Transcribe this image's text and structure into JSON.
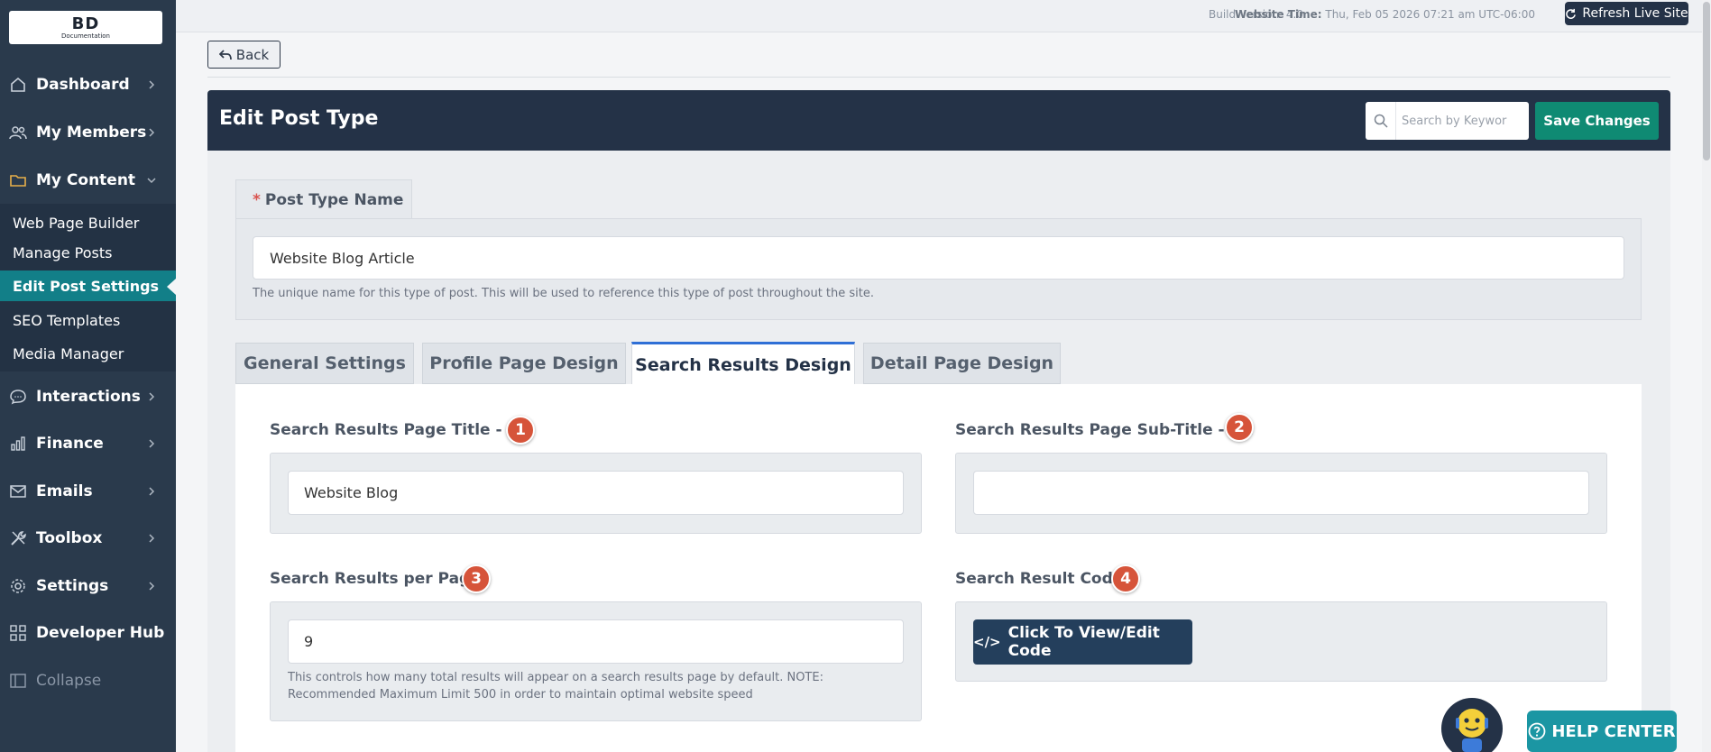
{
  "logo": {
    "main": "BD",
    "sub": "Documentation"
  },
  "sidebar": {
    "items": [
      {
        "label": "Dashboard",
        "icon": "home-icon"
      },
      {
        "label": "My Members",
        "icon": "users-icon"
      },
      {
        "label": "My Content",
        "icon": "folder-icon"
      },
      {
        "label": "Interactions",
        "icon": "chat-icon"
      },
      {
        "label": "Finance",
        "icon": "bar-chart-icon"
      },
      {
        "label": "Emails",
        "icon": "email-icon"
      },
      {
        "label": "Toolbox",
        "icon": "tools-icon"
      },
      {
        "label": "Settings",
        "icon": "gear-icon"
      },
      {
        "label": "Developer Hub",
        "icon": "grid-icon"
      },
      {
        "label": "Collapse",
        "icon": "sidebar-icon"
      }
    ],
    "submenu": [
      {
        "label": "Web Page Builder"
      },
      {
        "label": "Manage Posts"
      },
      {
        "label": "Edit Post Settings"
      },
      {
        "label": "SEO Templates"
      },
      {
        "label": "Media Manager"
      }
    ]
  },
  "topbar": {
    "build_version": "Build Version: 4.0",
    "website_time_label": "Website Time:",
    "website_time_value": "Thu, Feb 05 2026 07:21 am UTC-06:00",
    "refresh_label": "Refresh Live Site"
  },
  "back_label": "Back",
  "header": {
    "title": "Edit Post Type",
    "search_placeholder": "Search by Keywor",
    "save_label": "Save Changes"
  },
  "post_type_name": {
    "required_mark": "*",
    "label": "Post Type Name",
    "value": "Website Blog Article",
    "help": "The unique name for this type of post. This will be used to reference this type of post throughout the site."
  },
  "tabs": [
    {
      "label": "General Settings"
    },
    {
      "label": "Profile Page Design"
    },
    {
      "label": "Search Results Design"
    },
    {
      "label": "Detail Page Design"
    }
  ],
  "fields": {
    "title_h1": {
      "label": "Search Results Page Title - H1",
      "badge": "1",
      "value": "Website Blog"
    },
    "subtitle_h2": {
      "label": "Search Results Page Sub-Title - H2",
      "badge": "2",
      "value": ""
    },
    "per_page": {
      "label": "Search Results per Page",
      "badge": "3",
      "value": "9",
      "help": "This controls how many total results will appear on a search results page by default. NOTE: Recommended Maximum Limit 500 in order to maintain optimal website speed"
    },
    "result_code": {
      "label": "Search Result Code",
      "badge": "4",
      "button": "Click To View/Edit Code"
    }
  },
  "help_center_label": "HELP CENTER"
}
